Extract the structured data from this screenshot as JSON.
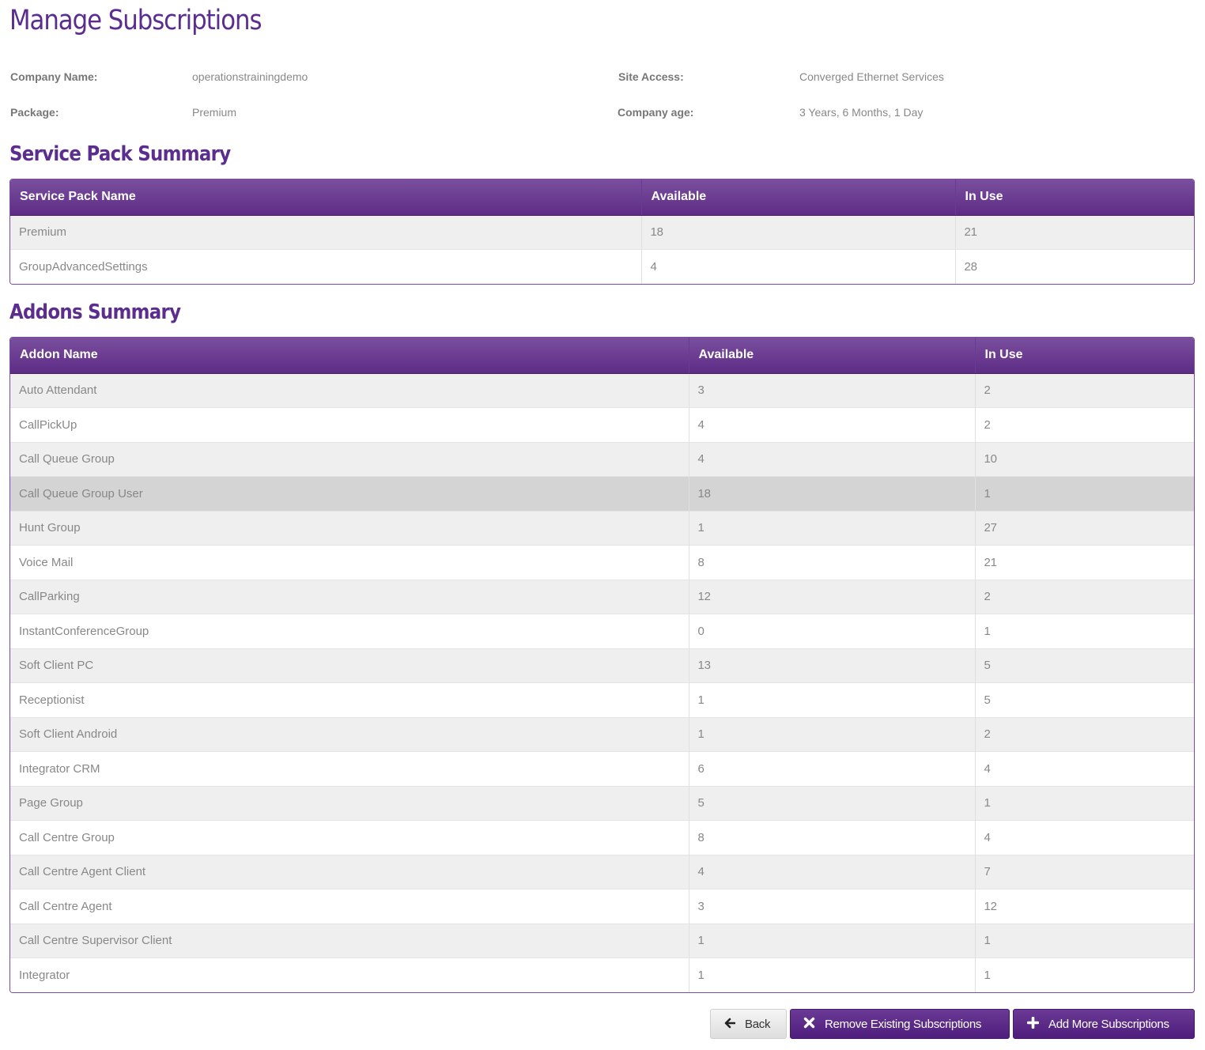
{
  "page": {
    "title": "Manage Subscriptions"
  },
  "company_info": {
    "company_name_label": "Company Name:",
    "company_name_value": "operationstrainingdemo",
    "package_label": "Package:",
    "package_value": "Premium",
    "site_access_label": "Site Access:",
    "site_access_value": "Converged Ethernet Services",
    "company_age_label": "Company age:",
    "company_age_value": "3 Years, 6 Months, 1 Day"
  },
  "service_pack_summary": {
    "title": "Service Pack Summary",
    "columns": [
      "Service Pack Name",
      "Available",
      "In Use"
    ],
    "rows": [
      {
        "name": "Premium",
        "available": "18",
        "in_use": "21"
      },
      {
        "name": "GroupAdvancedSettings",
        "available": "4",
        "in_use": "28"
      }
    ]
  },
  "addons_summary": {
    "title": "Addons Summary",
    "columns": [
      "Addon Name",
      "Available",
      "In Use"
    ],
    "highlighted_row": "Call Queue Group User",
    "rows": [
      {
        "name": "Auto Attendant",
        "available": "3",
        "in_use": "2"
      },
      {
        "name": "CallPickUp",
        "available": "4",
        "in_use": "2"
      },
      {
        "name": "Call Queue Group",
        "available": "4",
        "in_use": "10"
      },
      {
        "name": "Call Queue Group User",
        "available": "18",
        "in_use": "1"
      },
      {
        "name": "Hunt Group",
        "available": "1",
        "in_use": "27"
      },
      {
        "name": "Voice Mail",
        "available": "8",
        "in_use": "21"
      },
      {
        "name": "CallParking",
        "available": "12",
        "in_use": "2"
      },
      {
        "name": "InstantConferenceGroup",
        "available": "0",
        "in_use": "1"
      },
      {
        "name": "Soft Client PC",
        "available": "13",
        "in_use": "5"
      },
      {
        "name": "Receptionist",
        "available": "1",
        "in_use": "5"
      },
      {
        "name": "Soft Client Android",
        "available": "1",
        "in_use": "2"
      },
      {
        "name": "Integrator CRM",
        "available": "6",
        "in_use": "4"
      },
      {
        "name": "Page Group",
        "available": "5",
        "in_use": "1"
      },
      {
        "name": "Call Centre Group",
        "available": "8",
        "in_use": "4"
      },
      {
        "name": "Call Centre Agent Client",
        "available": "4",
        "in_use": "7"
      },
      {
        "name": "Call Centre Agent",
        "available": "3",
        "in_use": "12"
      },
      {
        "name": "Call Centre Supervisor Client",
        "available": "1",
        "in_use": "1"
      },
      {
        "name": "Integrator",
        "available": "1",
        "in_use": "1"
      }
    ]
  },
  "actions": {
    "back": {
      "label": "Back",
      "icon": "arrow-left-icon"
    },
    "remove": {
      "label": "Remove Existing Subscriptions",
      "icon": "x-icon"
    },
    "add": {
      "label": "Add More Subscriptions",
      "icon": "plus-icon"
    }
  },
  "colors": {
    "brand_purple": "#5b2d8e",
    "header_gradient_top": "#7a4f9e",
    "header_gradient_bottom": "#5e2c86",
    "row_stripe": "#efefef",
    "row_hover": "#d4d4d4"
  }
}
